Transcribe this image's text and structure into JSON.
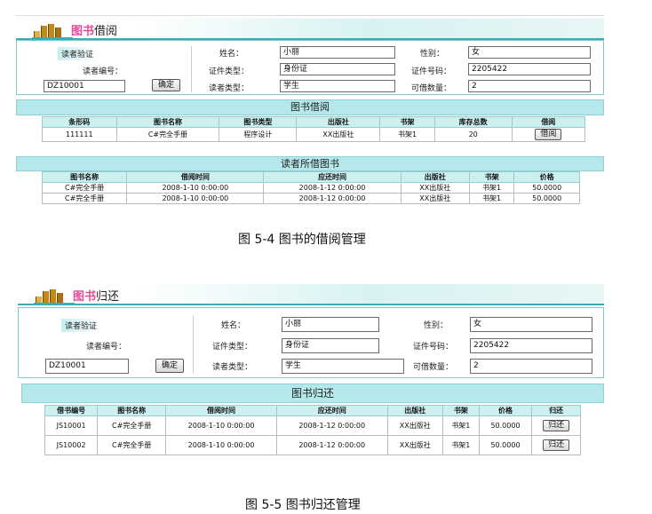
{
  "borrow": {
    "header": {
      "title_em": "图书",
      "title_rest": "借阅"
    },
    "form": {
      "verify_label": "读者验证",
      "reader_no_label": "读者编号：",
      "reader_no_value": "DZ10001",
      "confirm_label": "确定",
      "name_label": "姓名：",
      "name_value": "小丽",
      "id_type_label": "证件类型：",
      "id_type_value": "身份证",
      "reader_type_label": "读者类型：",
      "reader_type_value": "学生",
      "gender_label": "性别：",
      "gender_value": "女",
      "id_no_label": "证件号码：",
      "id_no_value": "2205422",
      "quota_label": "可借数量：",
      "quota_value": "2"
    },
    "book_section_title": "图书借阅",
    "book_table": {
      "headers": [
        "条形码",
        "图书名称",
        "图书类型",
        "出版社",
        "书架",
        "库存总数",
        "借阅"
      ],
      "rows": [
        {
          "barcode": "111111",
          "name": "C#完全手册",
          "type": "程序设计",
          "publisher": "XX出版社",
          "shelf": "书架1",
          "stock": "20",
          "action": "借阅"
        }
      ]
    },
    "borrowed_section_title": "读者所借图书",
    "borrowed_table": {
      "headers": [
        "图书名称",
        "借阅时间",
        "应还时间",
        "出版社",
        "书架",
        "价格"
      ],
      "rows": [
        {
          "name": "C#完全手册",
          "borrow_time": "2008-1-10 0:00:00",
          "due_time": "2008-1-12 0:00:00",
          "publisher": "XX出版社",
          "shelf": "书架1",
          "price": "50.0000"
        },
        {
          "name": "C#完全手册",
          "borrow_time": "2008-1-10 0:00:00",
          "due_time": "2008-1-12 0:00:00",
          "publisher": "XX出版社",
          "shelf": "书架1",
          "price": "50.0000"
        }
      ]
    },
    "caption": "图 5-4   图书的借阅管理"
  },
  "return": {
    "header": {
      "title_em": "图书",
      "title_rest": "归还"
    },
    "form": {
      "verify_label": "读者验证",
      "reader_no_label": "读者编号：",
      "reader_no_value": "DZ10001",
      "confirm_label": "确定",
      "name_label": "姓名：",
      "name_value": "小丽",
      "id_type_label": "证件类型：",
      "id_type_value": "身份证",
      "reader_type_label": "读者类型：",
      "reader_type_value": "学生",
      "gender_label": "性别：",
      "gender_value": "女",
      "id_no_label": "证件号码：",
      "id_no_value": "2205422",
      "quota_label": "可借数量：",
      "quota_value": "2"
    },
    "section_title": "图书归还",
    "table": {
      "headers": [
        "借书编号",
        "图书名称",
        "借阅时间",
        "应还时间",
        "出版社",
        "书架",
        "价格",
        "归还"
      ],
      "rows": [
        {
          "id": "JS10001",
          "name": "C#完全手册",
          "borrow_time": "2008-1-10 0:00:00",
          "due_time": "2008-1-12 0:00:00",
          "publisher": "XX出版社",
          "shelf": "书架1",
          "price": "50.0000",
          "action": "归还"
        },
        {
          "id": "JS10002",
          "name": "C#完全手册",
          "borrow_time": "2008-1-10 0:00:00",
          "due_time": "2008-1-12 0:00:00",
          "publisher": "XX出版社",
          "shelf": "书架1",
          "price": "50.0000",
          "action": "归还"
        }
      ]
    },
    "caption": "图 5-5   图书归还管理"
  },
  "colors": {
    "accent": "#38aeb4",
    "header_bg": "#b4e8ea",
    "title_pink": "#e24a9a"
  },
  "icons": {
    "logo": "bookshelf-logo-icon"
  }
}
